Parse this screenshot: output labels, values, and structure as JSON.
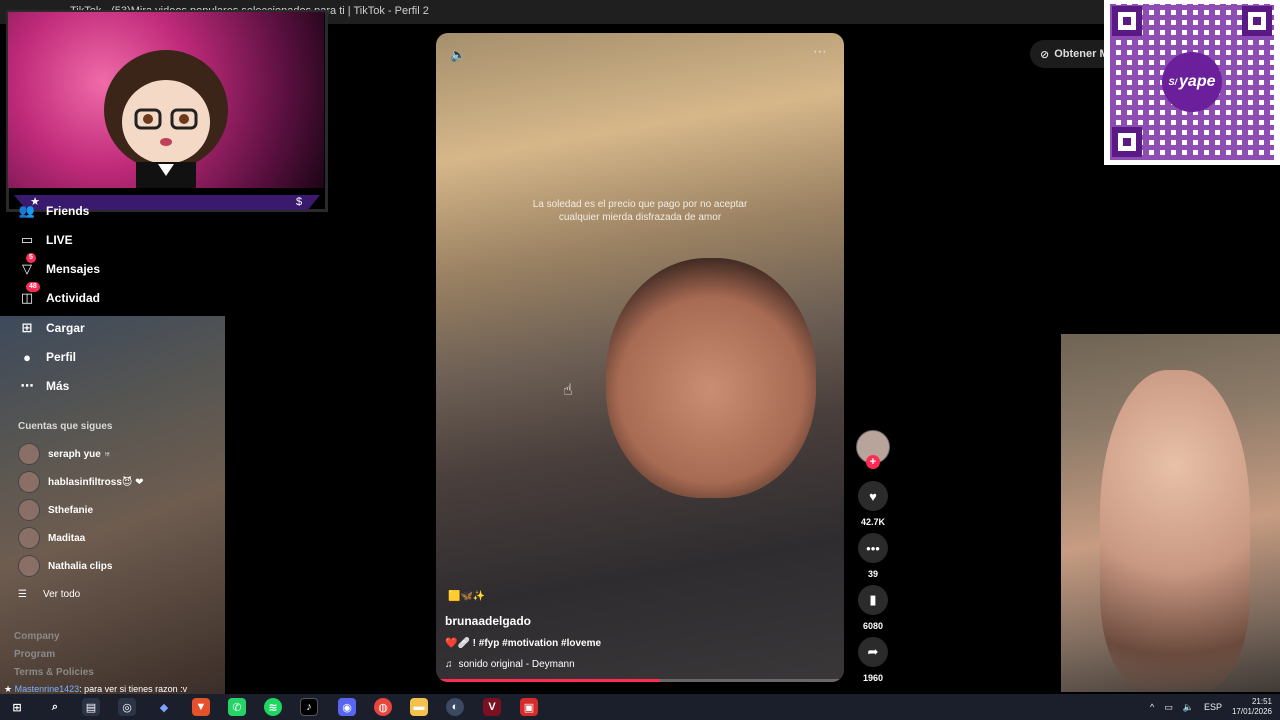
{
  "browser": {
    "title": "TikTok - (53)Mira videos populares seleccionados para ti | TikTok - Perfil 2"
  },
  "sidebar": {
    "items": [
      {
        "label": "Friends",
        "icon": "friends-icon"
      },
      {
        "label": "LIVE",
        "icon": "live-icon"
      },
      {
        "label": "Mensajes",
        "icon": "messages-icon",
        "badge": "5"
      },
      {
        "label": "Actividad",
        "icon": "activity-icon",
        "badge": "48"
      },
      {
        "label": "Cargar",
        "icon": "upload-icon"
      },
      {
        "label": "Perfil",
        "icon": "profile-icon"
      },
      {
        "label": "Más",
        "icon": "more-icon"
      }
    ],
    "following_heading": "Cuentas que sigues",
    "following": [
      {
        "name": "seraph yue ♅"
      },
      {
        "name": "hablasinfiltross😈 ❤"
      },
      {
        "name": "Sthefanie"
      },
      {
        "name": "Maditaa"
      },
      {
        "name": "Nathalia clips"
      }
    ],
    "see_all": "Ver todo",
    "footer": [
      "Company",
      "Program",
      "Terms & Policies"
    ]
  },
  "chat": {
    "user": "Mastenrine1423",
    "message": ": para ver si tienes razon :v"
  },
  "video": {
    "caption": "La soledad es el precio que pago por no aceptar cualquier mierda disfrazada de amor",
    "emojis": "🟨🦋✨",
    "author": "brunaadelgado",
    "description": "❤️🩹 ! #fyp #motivation #loveme",
    "sound": "sonido original - Deymann",
    "progress_fraction": 0.55
  },
  "actions": {
    "likes": "42.7K",
    "comments": "39",
    "saves": "6080",
    "shares": "1960"
  },
  "header": {
    "get_app": "Obtener M"
  },
  "qr": {
    "brand": "yape",
    "currency": "S/"
  },
  "taskbar": {
    "language": "ESP",
    "time": "21:51",
    "date": "17/01/2026"
  },
  "colors": {
    "accent": "#fe2c55",
    "yape": "#6b1f9a"
  }
}
